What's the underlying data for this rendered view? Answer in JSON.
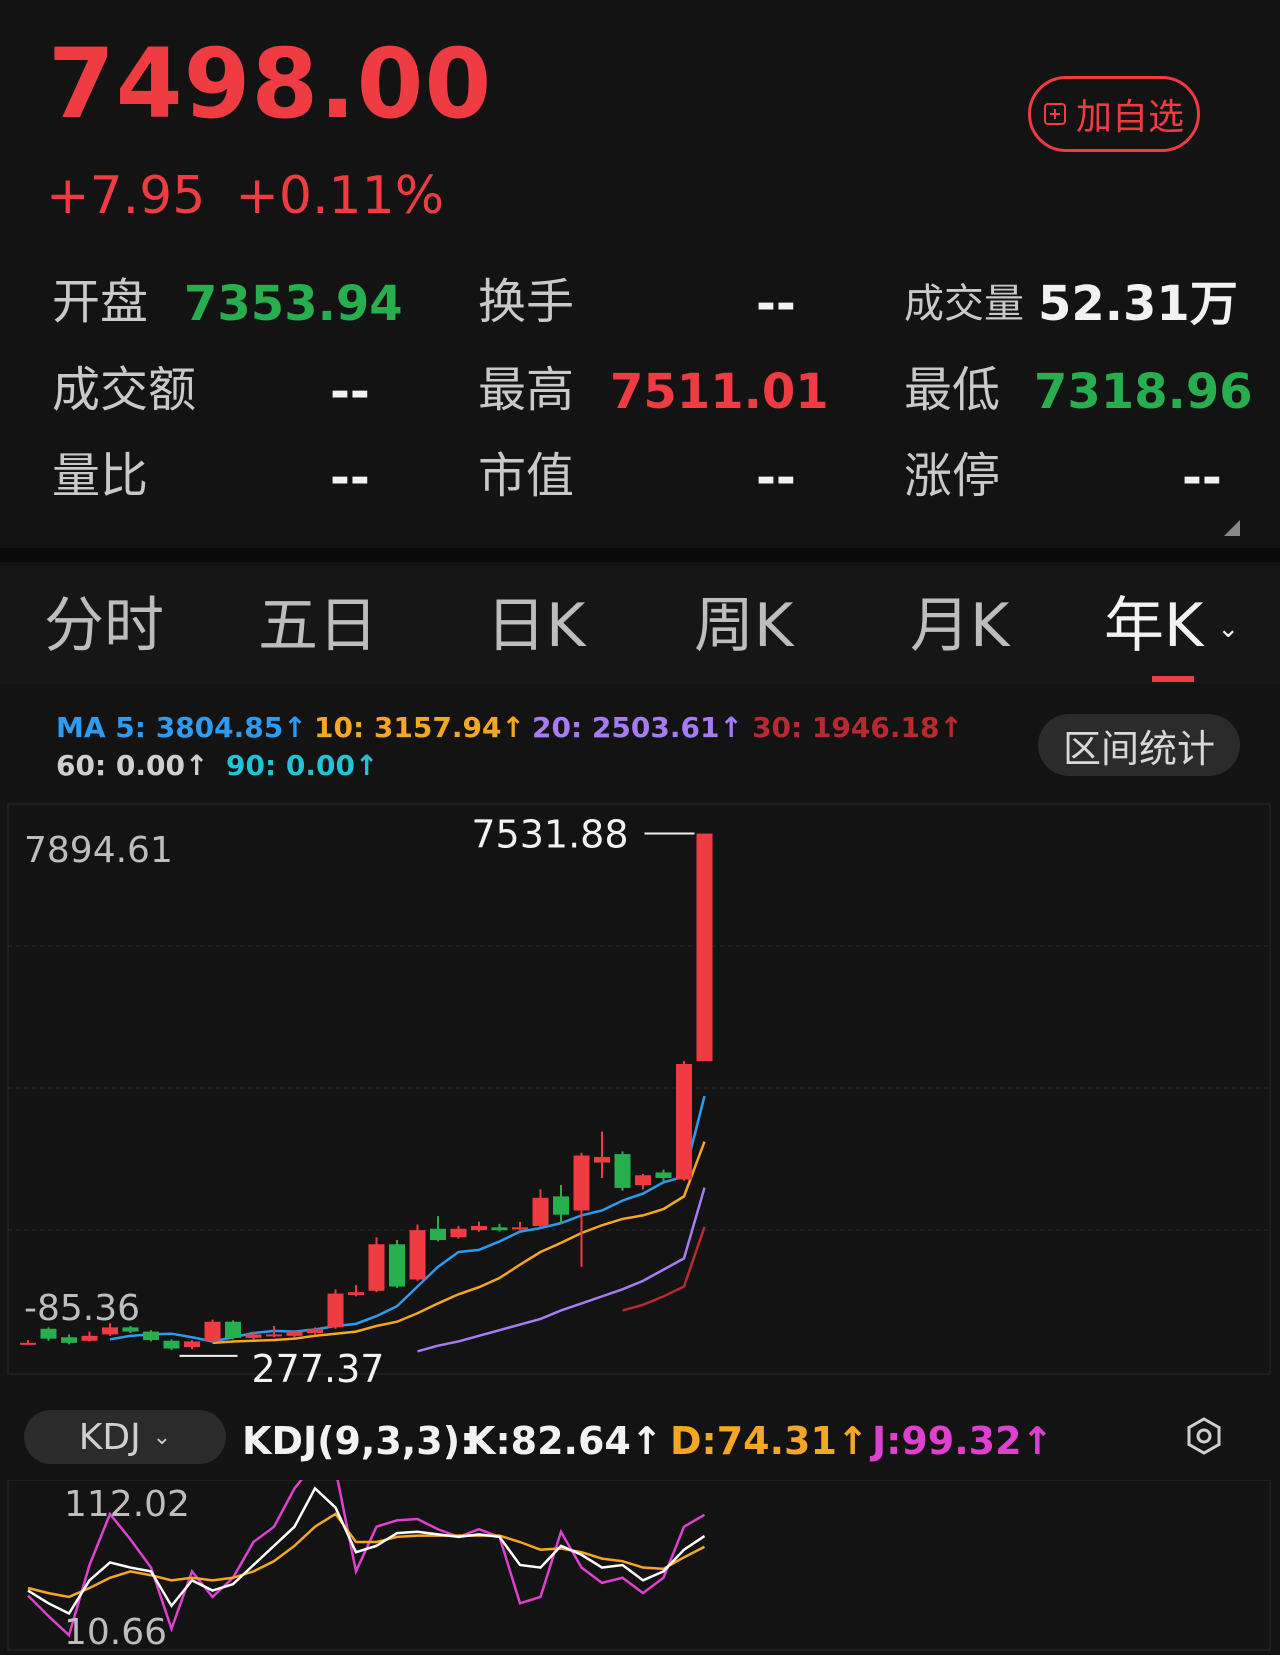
{
  "quote": {
    "price": "7498.00",
    "change": "+7.95",
    "change_pct": "+0.11%",
    "watch_label": "加自选"
  },
  "stats": {
    "open_label": "开盘",
    "open_value": "7353.94",
    "turnover_label": "换手",
    "turnover_value": "--",
    "volume_label": "成交量",
    "volume_value": "52.31万",
    "amount_label": "成交额",
    "amount_value": "--",
    "high_label": "最高",
    "high_value": "7511.01",
    "low_label": "最低",
    "low_value": "7318.96",
    "ratio_label": "量比",
    "ratio_value": "--",
    "mcap_label": "市值",
    "mcap_value": "--",
    "limit_label": "涨停",
    "limit_value": "--"
  },
  "tabs": [
    {
      "label": "分时"
    },
    {
      "label": "五日"
    },
    {
      "label": "日K"
    },
    {
      "label": "周K"
    },
    {
      "label": "月K"
    },
    {
      "label": "年K"
    }
  ],
  "ma_legend": {
    "ma5": "MA 5: 3804.85↑",
    "ma10": "10: 3157.94↑",
    "ma20": "20: 2503.61↑",
    "ma30": "30: 1946.18↑",
    "ma60": "60: 0.00↑",
    "ma90": "90: 0.00↑"
  },
  "range_stats_label": "区间统计",
  "kdj": {
    "selector_label": "KDJ",
    "params": "KDJ(9,3,3):",
    "k": "K:82.64↑",
    "d": "D:74.31↑",
    "j": "J:99.32↑"
  },
  "colors": {
    "up": "#ef3b42",
    "down": "#27ae4f",
    "ma5": "#2f9bf0",
    "ma10": "#f5a623",
    "ma20": "#a77bf3",
    "ma30": "#b82a2f",
    "ma60": "#cfcfcf",
    "ma90": "#22c3d6",
    "k": "#ffffff",
    "d": "#f5a623",
    "j": "#e040d0"
  },
  "chart_data": [
    {
      "type": "candlestick",
      "y_axis_top_label": "7894.61",
      "y_axis_bottom_label": "-85.36",
      "max_marker": "7531.88",
      "min_marker": "277.37",
      "ylim": [
        -85.36,
        7894.61
      ],
      "candles": [
        {
          "o": 300,
          "c": 300,
          "h": 340,
          "l": 290
        },
        {
          "o": 500,
          "c": 360,
          "h": 520,
          "l": 330
        },
        {
          "o": 380,
          "c": 300,
          "h": 420,
          "l": 280
        },
        {
          "o": 330,
          "c": 400,
          "h": 460,
          "l": 320
        },
        {
          "o": 420,
          "c": 520,
          "h": 580,
          "l": 400
        },
        {
          "o": 520,
          "c": 460,
          "h": 540,
          "l": 440
        },
        {
          "o": 460,
          "c": 340,
          "h": 480,
          "l": 320
        },
        {
          "o": 330,
          "c": 220,
          "h": 350,
          "l": 200
        },
        {
          "o": 240,
          "c": 320,
          "h": 340,
          "l": 210
        },
        {
          "o": 330,
          "c": 600,
          "h": 630,
          "l": 310
        },
        {
          "o": 600,
          "c": 370,
          "h": 620,
          "l": 350
        },
        {
          "o": 370,
          "c": 420,
          "h": 460,
          "l": 350
        },
        {
          "o": 400,
          "c": 420,
          "h": 540,
          "l": 380
        },
        {
          "o": 400,
          "c": 460,
          "h": 480,
          "l": 380
        },
        {
          "o": 440,
          "c": 500,
          "h": 520,
          "l": 420
        },
        {
          "o": 520,
          "c": 1000,
          "h": 1060,
          "l": 500
        },
        {
          "o": 980,
          "c": 1020,
          "h": 1120,
          "l": 960
        },
        {
          "o": 1040,
          "c": 1700,
          "h": 1800,
          "l": 1020
        },
        {
          "o": 1700,
          "c": 1100,
          "h": 1760,
          "l": 1080
        },
        {
          "o": 1200,
          "c": 1900,
          "h": 1980,
          "l": 1180
        },
        {
          "o": 1920,
          "c": 1760,
          "h": 2100,
          "l": 1740
        },
        {
          "o": 1800,
          "c": 1920,
          "h": 1960,
          "l": 1780
        },
        {
          "o": 1900,
          "c": 1960,
          "h": 2020,
          "l": 1880
        },
        {
          "o": 1940,
          "c": 1900,
          "h": 1990,
          "l": 1880
        },
        {
          "o": 1920,
          "c": 1940,
          "h": 2020,
          "l": 1900
        },
        {
          "o": 1960,
          "c": 2360,
          "h": 2480,
          "l": 1940
        },
        {
          "o": 2380,
          "c": 2120,
          "h": 2540,
          "l": 1980
        },
        {
          "o": 2180,
          "c": 2960,
          "h": 3000,
          "l": 1380
        },
        {
          "o": 2860,
          "c": 2940,
          "h": 3300,
          "l": 2640
        },
        {
          "o": 2980,
          "c": 2500,
          "h": 3020,
          "l": 2460
        },
        {
          "o": 2540,
          "c": 2680,
          "h": 2700,
          "l": 2480
        },
        {
          "o": 2720,
          "c": 2640,
          "h": 2760,
          "l": 2600
        },
        {
          "o": 2620,
          "c": 4260,
          "h": 4300,
          "l": 2600
        },
        {
          "o": 4300,
          "c": 7531.88,
          "h": 7531.88,
          "l": 4300
        }
      ],
      "ma5": [
        null,
        null,
        null,
        null,
        350,
        400,
        420,
        430,
        380,
        320,
        380,
        440,
        470,
        460,
        490,
        540,
        570,
        680,
        820,
        1100,
        1380,
        1590,
        1620,
        1740,
        1880,
        1930,
        2000,
        2110,
        2180,
        2320,
        2420,
        2580,
        2660,
        3804.85
      ],
      "ma10": [
        null,
        null,
        null,
        null,
        null,
        null,
        null,
        null,
        null,
        300,
        320,
        330,
        340,
        360,
        400,
        430,
        460,
        540,
        600,
        720,
        860,
        990,
        1090,
        1220,
        1410,
        1590,
        1720,
        1860,
        1970,
        2060,
        2110,
        2200,
        2380,
        3157.94
      ],
      "ma20": [
        null,
        null,
        null,
        null,
        null,
        null,
        null,
        null,
        null,
        null,
        null,
        null,
        null,
        null,
        null,
        null,
        null,
        null,
        null,
        180,
        260,
        320,
        400,
        480,
        560,
        640,
        760,
        860,
        960,
        1060,
        1180,
        1340,
        1500,
        2503.61
      ],
      "ma30": [
        null,
        null,
        null,
        null,
        null,
        null,
        null,
        null,
        null,
        null,
        null,
        null,
        null,
        null,
        null,
        null,
        null,
        null,
        null,
        null,
        null,
        null,
        null,
        null,
        null,
        null,
        null,
        null,
        null,
        760,
        840,
        960,
        1100,
        1946.18
      ]
    },
    {
      "type": "line",
      "title": "KDJ(9,3,3)",
      "y_axis_top_label": "112.02",
      "y_axis_bottom_label": "10.66",
      "ylim": [
        -5,
        125
      ],
      "series": [
        {
          "name": "K",
          "values": [
            40,
            30,
            22,
            48,
            62,
            58,
            55,
            28,
            48,
            40,
            45,
            60,
            75,
            90,
            120,
            105,
            70,
            75,
            85,
            86,
            84,
            82,
            84,
            82,
            60,
            58,
            75,
            68,
            58,
            60,
            48,
            55,
            72,
            82.64
          ]
        },
        {
          "name": "D",
          "values": [
            42,
            38,
            35,
            42,
            50,
            55,
            52,
            48,
            50,
            48,
            50,
            55,
            63,
            75,
            90,
            100,
            78,
            78,
            82,
            83,
            83,
            83,
            83,
            83,
            78,
            72,
            73,
            70,
            65,
            63,
            58,
            57,
            66,
            74.31
          ]
        },
        {
          "name": "J",
          "values": [
            36,
            20,
            5,
            60,
            100,
            80,
            58,
            10,
            55,
            35,
            50,
            78,
            90,
            120,
            140,
            135,
            55,
            90,
            95,
            96,
            88,
            82,
            88,
            82,
            30,
            35,
            86,
            58,
            46,
            50,
            38,
            50,
            90,
            99.32
          ]
        }
      ]
    }
  ]
}
